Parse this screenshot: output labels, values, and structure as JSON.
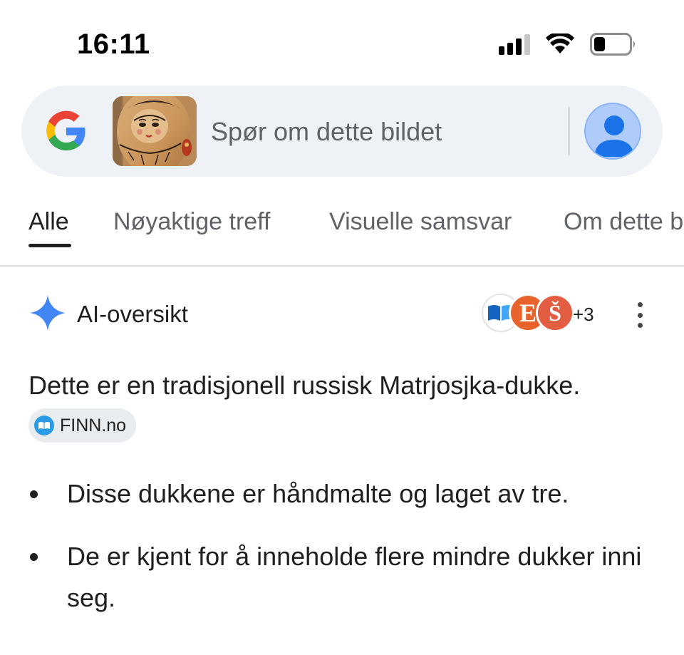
{
  "status_bar": {
    "time": "16:11",
    "icons": [
      "cellular-signal-icon",
      "wifi-icon",
      "battery-icon"
    ],
    "battery_level": 0.25
  },
  "search": {
    "placeholder": "Spør om dette bildet",
    "logo": "google-g-icon",
    "thumbnail": "matryoshka-doll-thumbnail",
    "avatar": "account-avatar-icon"
  },
  "tabs": [
    {
      "label": "Alle",
      "active": true
    },
    {
      "label": "Nøyaktige treff",
      "active": false
    },
    {
      "label": "Visuelle samsvar",
      "active": false
    },
    {
      "label": "Om dette b",
      "active": false
    }
  ],
  "ai_overview": {
    "title": "AI-oversikt",
    "sources_more": "+3",
    "source_e_letter": "E",
    "source_s_letter": "Š",
    "intro": "Dette er en tradisjonell russisk Matrjosjka-dukke.",
    "citation_chip": "FINN.no",
    "bullets": [
      "Disse dukkene er håndmalte og laget av tre.",
      "De er kjent for å inneholde flere mindre dukker inni seg."
    ]
  },
  "colors": {
    "search_bg": "#eef1f5",
    "ai_star_blue": "#4285f4",
    "source_orange": "#e8632b",
    "chip_bg": "#e9ecef"
  }
}
